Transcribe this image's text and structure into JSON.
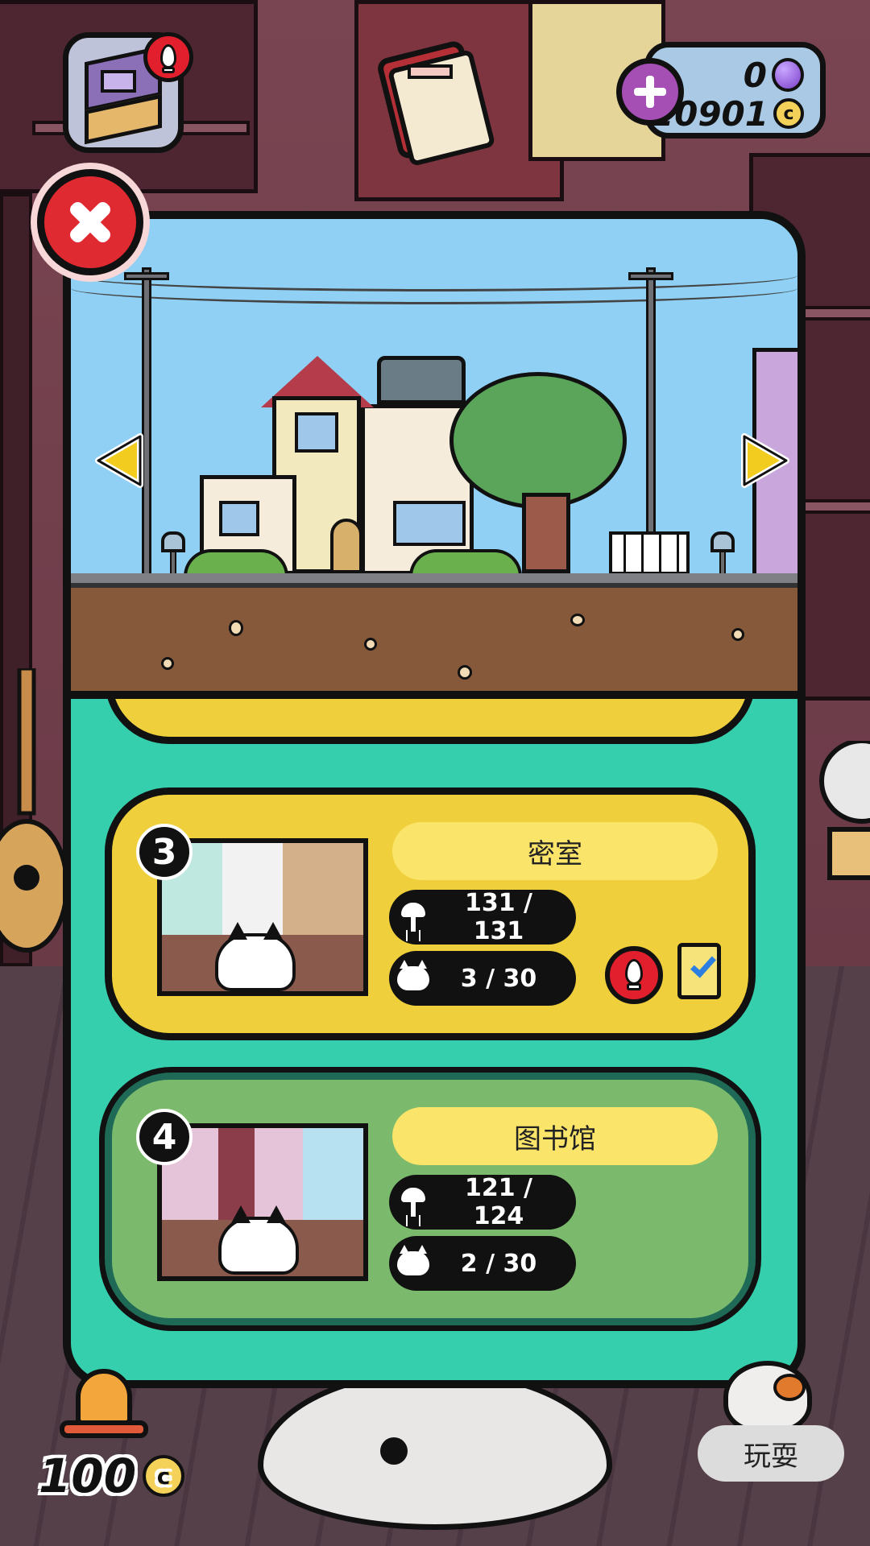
{
  "hud": {
    "gems": "0",
    "coins": "20901",
    "coin_symbol": "c",
    "bottom_coins": "100",
    "play_label": "玩耍"
  },
  "rooms": [
    {
      "number": "3",
      "name": "密室",
      "furniture": "131 / 131",
      "cats": "3 / 30",
      "has_alert": true,
      "has_document": true,
      "card_color": "#efd03c"
    },
    {
      "number": "4",
      "name": "图书馆",
      "furniture": "121 / 124",
      "cats": "2 / 30",
      "has_alert": false,
      "has_document": false,
      "card_color": "#7bba6c"
    }
  ],
  "colors": {
    "modal_bg": "#36cfae",
    "close": "#e02a31",
    "alert": "#e21f2c",
    "room_name_pill": "#fbe46a",
    "sky": "#8fd0f4",
    "arrow": "#f2cc1f"
  },
  "icons": {
    "close": "close-icon",
    "prev": "arrow-left-icon",
    "next": "arrow-right-icon",
    "furniture": "lamp-icon",
    "cats": "cat-icon",
    "alert": "exclamation-alert-icon",
    "doc": "document-check-icon",
    "gem": "gem-icon",
    "coin": "coin-icon"
  }
}
